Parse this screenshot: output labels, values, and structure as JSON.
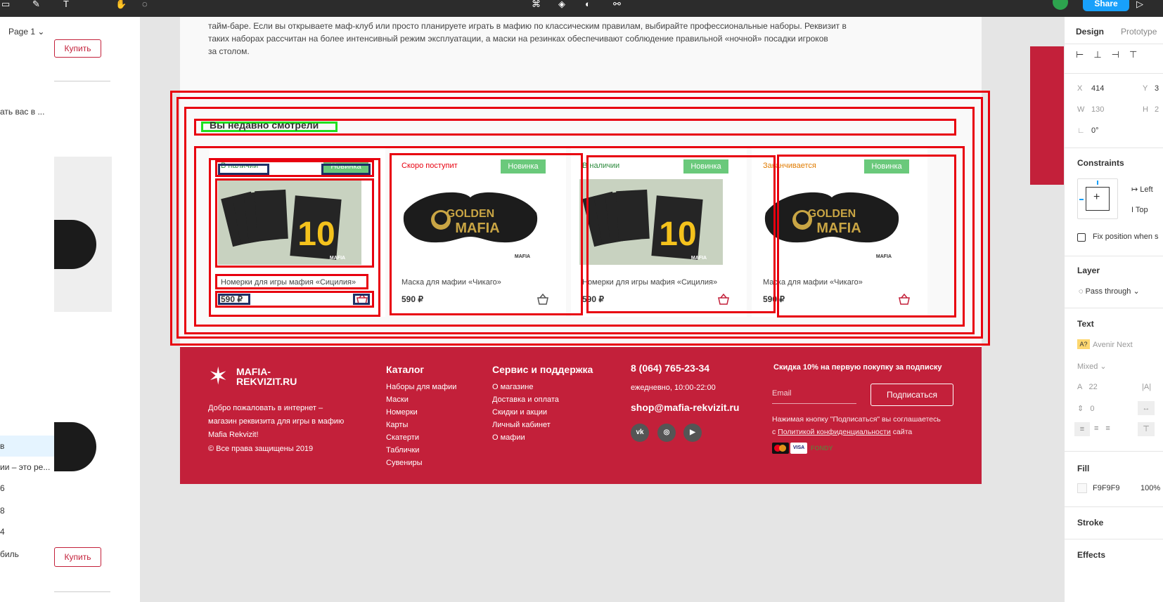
{
  "toolbar": {
    "share_label": "Share"
  },
  "left_panel": {
    "page_selector": "Page 1",
    "layer_items": [
      "ать вас в ...",
      "в",
      "ии – это ре...",
      "6",
      "8",
      "4",
      "биль"
    ]
  },
  "left_canvas": {
    "buy_button_top": "Купить",
    "buy_button_bottom": "Купить"
  },
  "page": {
    "intro_text_line1": "тайм-баре. Если вы открываете маф-клуб или просто планируете играть в мафию по классическим правилам, выбирайте профессиональные наборы. Реквизит в",
    "intro_text_line2": "таких наборах рассчитан на более интенсивный режим эксплуатации, а маски на резинках обеспечивают соблюдение правильной «ночной» посадки игроков",
    "intro_text_line3": "за столом.",
    "recent_title": "Вы недавно смотрели",
    "cards": [
      {
        "availability": "В наличии",
        "availability_color": "#2e8b3e",
        "badge": "Новинка",
        "image": "numbers",
        "title": "Номерки для игры мафия «Сицилия»",
        "price": "590 ₽"
      },
      {
        "availability": "Скоро поступит",
        "availability_color": "#e8000f",
        "badge": "Новинка",
        "image": "mask",
        "title": "Маска для мафии «Чикаго»",
        "price": "590 ₽"
      },
      {
        "availability": "В наличии",
        "availability_color": "#2e8b3e",
        "badge": "Новинка",
        "image": "numbers",
        "title": "Номерки для игры мафия «Сицилия»",
        "price": "590 ₽"
      },
      {
        "availability": "Заканчивается",
        "availability_color": "#e07b00",
        "badge": "Новинка",
        "image": "mask",
        "title": "Маска для мафии «Чикаго»",
        "price": "590 ₽"
      }
    ],
    "image_text": {
      "mask_line1": "GOLDEN",
      "mask_line2": "MAFIA",
      "numbers_digit": "10",
      "logo_small": "MAFIA REKVIZIT"
    }
  },
  "footer": {
    "logo_text": "MAFIA-REKVIZIT.RU",
    "welcome_line1": "Добро пожаловать в интернет –",
    "welcome_line2": "магазин реквизита для игры в мафию",
    "welcome_line3": "Mafia Rekvizit!",
    "copyright": "© Все права защищены 2019",
    "catalog_title": "Каталог",
    "catalog_links": [
      "Наборы для мафии",
      "Маски",
      "Номерки",
      "Карты",
      "Скатерти",
      "Таблички",
      "Сувениры"
    ],
    "service_title": "Сервис и поддержка",
    "service_links": [
      "О магазине",
      "Доставка и оплата",
      "Скидки и акции",
      "Личный кабинет",
      "О мафии"
    ],
    "phone": "8 (064) 765-23-34",
    "hours": "ежедневно, 10:00-22:00",
    "email": "shop@mafia-rekvizit.ru",
    "social": [
      "vk-icon",
      "instagram-icon",
      "youtube-icon"
    ],
    "subscribe_title": "Скидка 10% на первую покупку за подписку",
    "email_placeholder": "Email",
    "subscribe_button": "Подписаться",
    "consent_line1": "Нажимая кнопку \"Подписаться\" вы соглашаетесь",
    "consent_prefix": "с ",
    "consent_link": "Политикой конфиденциальности",
    "consent_suffix": " сайта",
    "payments": [
      "MasterCard",
      "VISA",
      "FONDY"
    ]
  },
  "right_panel": {
    "tab_design": "Design",
    "tab_prototype": "Prototype",
    "x_label": "X",
    "x_value": "414",
    "y_label": "Y",
    "y_value": "3",
    "w_label": "W",
    "w_value": "130",
    "h_label": "H",
    "h_value": "2",
    "rotation": "0°",
    "constraints_title": "Constraints",
    "constraint_h": "Left",
    "constraint_v": "Top",
    "fix_position": "Fix position when s",
    "layer_title": "Layer",
    "blend_mode": "Pass through",
    "text_title": "Text",
    "font_name": "Avenir Next",
    "font_weight": "Mixed",
    "line_height": "22",
    "paragraph_spacing": "0",
    "fill_title": "Fill",
    "fill_hex": "F9F9F9",
    "fill_opacity": "100%",
    "stroke_title": "Stroke",
    "effects_title": "Effects"
  },
  "colors": {
    "brand_red": "#c3203a",
    "badge_green": "#6ac97b",
    "selection_red": "#e8000f",
    "figma_blue": "#18a0fb"
  }
}
